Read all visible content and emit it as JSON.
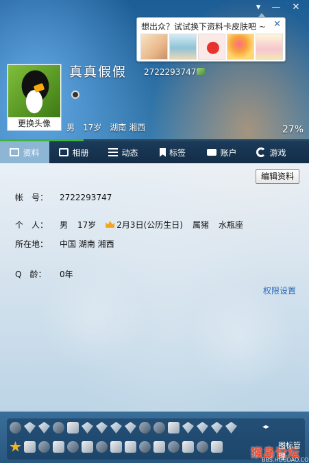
{
  "window": {
    "controls": [
      "▾",
      "—",
      "✕"
    ]
  },
  "skin_popup": {
    "text": "想出众？试试换下资料卡皮肤吧 ~",
    "close": "✕",
    "thumbs": [
      "skin-thumb-1",
      "skin-thumb-2",
      "skin-thumb-3",
      "skin-thumb-4",
      "skin-thumb-5"
    ]
  },
  "header": {
    "avatar_button": "更换头像",
    "nickname": "真真假假",
    "qq_number": "2722293747",
    "gender": "男",
    "age": "17岁",
    "location": "湖南 湘西",
    "completion": "27%",
    "completion_fraction": 0.27
  },
  "tabs": [
    {
      "label": "资料",
      "icon": "profile-card-icon",
      "active": true
    },
    {
      "label": "相册",
      "icon": "photo-icon",
      "active": false
    },
    {
      "label": "动态",
      "icon": "feed-icon",
      "active": false
    },
    {
      "label": "标签",
      "icon": "tag-icon",
      "active": false
    },
    {
      "label": "账户",
      "icon": "wallet-icon",
      "active": false
    },
    {
      "label": "游戏",
      "icon": "game-icon",
      "active": false
    }
  ],
  "profile": {
    "edit_button": "编辑资料",
    "account": {
      "label": "帐　号：",
      "value": "2722293747"
    },
    "personal": {
      "label": "个　人：",
      "gender": "男",
      "age": "17岁",
      "birthday": "2月3日(公历生日)",
      "zodiac": "属猪",
      "constellation": "水瓶座"
    },
    "location": {
      "label": "所在地：",
      "value": "中国 湖南 湘西"
    },
    "qage": {
      "label": "Q　龄：",
      "value": "0年"
    },
    "permission_link": "权限设置"
  },
  "icon_bar": {
    "manage_label": "图标管理",
    "arrows": "◂▸",
    "watermark_logo": "猴岛论坛",
    "watermark_url": "BBS.HOUDAO.COM"
  }
}
